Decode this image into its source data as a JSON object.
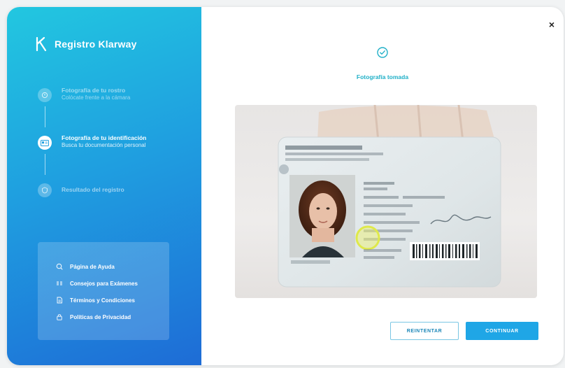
{
  "brand": {
    "name": "Registro Klarway",
    "logo_icon": "klarway-k-logo"
  },
  "steps": [
    {
      "title": "Fotografía de tu rostro",
      "subtitle": "Colócate frente a la cámara",
      "state": "done",
      "icon": "face-icon"
    },
    {
      "title": "Fotografía de tu identificación",
      "subtitle": "Busca tu documentación personal",
      "state": "active",
      "icon": "id-card-icon"
    },
    {
      "title": "Resultado del registro",
      "subtitle": "",
      "state": "pending",
      "icon": "shield-icon"
    }
  ],
  "help_links": [
    {
      "label": "Página de Ayuda",
      "icon": "help-icon"
    },
    {
      "label": "Consejos para Exámenes",
      "icon": "list-icon"
    },
    {
      "label": "Términos y Condiciones",
      "icon": "document-icon"
    },
    {
      "label": "Políticas de Privacidad",
      "icon": "lock-icon"
    }
  ],
  "status": {
    "text": "Fotografía tomada",
    "icon": "check-circle-icon"
  },
  "photo": {
    "alt": "Foto de la identificación"
  },
  "buttons": {
    "retry": "REINTENTAR",
    "continue": "CONTINUAR"
  },
  "close_icon": "×",
  "colors": {
    "accent": "#1fa6e6",
    "teal": "#20b0c8",
    "sidebar_top": "#22c7e0",
    "sidebar_bottom": "#1e6cd6"
  }
}
